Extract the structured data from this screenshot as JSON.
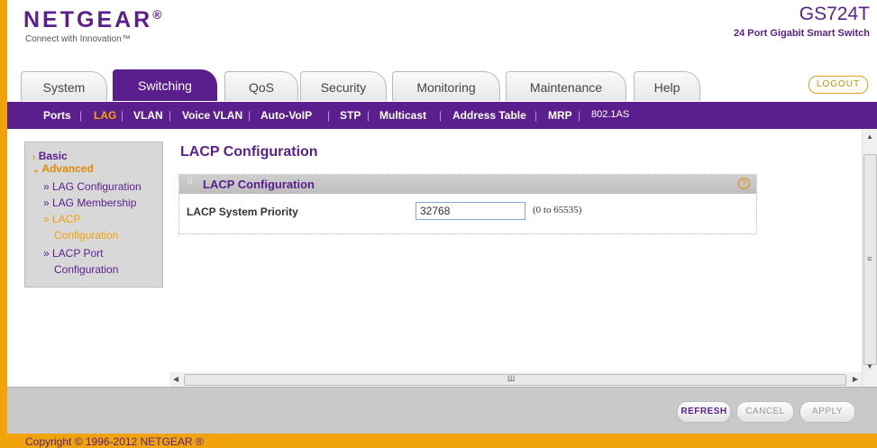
{
  "brand": {
    "logo": "NETGEAR",
    "logo_mark": "®",
    "tagline": "Connect with Innovation™"
  },
  "device": {
    "model": "GS724T",
    "description": "24 Port Gigabit Smart Switch"
  },
  "logout_label": "LOGOUT",
  "tabs": [
    {
      "label": "System"
    },
    {
      "label": "Switching"
    },
    {
      "label": "QoS"
    },
    {
      "label": "Security"
    },
    {
      "label": "Monitoring"
    },
    {
      "label": "Maintenance"
    },
    {
      "label": "Help"
    }
  ],
  "subnav": [
    {
      "label": "Ports"
    },
    {
      "label": "LAG"
    },
    {
      "label": "VLAN"
    },
    {
      "label": "Voice VLAN"
    },
    {
      "label": "Auto-VoIP"
    },
    {
      "label": "STP"
    },
    {
      "label": "Multicast"
    },
    {
      "label": "Address Table"
    },
    {
      "label": "MRP"
    },
    {
      "label": "802.1AS"
    }
  ],
  "sidebar": {
    "basic": "Basic",
    "advanced": "Advanced",
    "items": [
      {
        "label": "» LAG Configuration"
      },
      {
        "label": "» LAG Membership"
      },
      {
        "label": "» LACP"
      },
      {
        "label": "Configuration"
      },
      {
        "label": "» LACP Port"
      },
      {
        "label": "Configuration"
      }
    ]
  },
  "page_title": "LACP Configuration",
  "panel": {
    "title": "LACP Configuration",
    "help_label": "?",
    "field_label": "LACP System Priority",
    "field_value": "32768",
    "field_range": "(0 to 65535)"
  },
  "buttons": {
    "refresh": "REFRESH",
    "cancel": "CANCEL",
    "apply": "APPLY"
  },
  "copyright": "Copyright © 1996-2012 NETGEAR ®",
  "colors": {
    "brand_purple": "#5a1f8c",
    "accent_orange": "#f0a30a"
  }
}
